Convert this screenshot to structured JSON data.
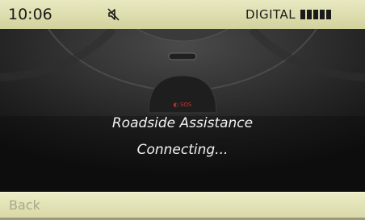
{
  "status_bar": {
    "time": "10:06",
    "signal_label": "DIGITAL",
    "signal_bars": 5,
    "mute_icon": "speaker-muted-icon"
  },
  "message": {
    "title": "Roadside Assistance",
    "status": "Connecting..."
  },
  "menu": {
    "back_label": "Back"
  },
  "colors": {
    "status_bar": "#e0e0b4",
    "menu_bar": "#e4e4bb",
    "background": "#141414",
    "text": "#f1f1f1",
    "sos_red": "#c0392b"
  }
}
